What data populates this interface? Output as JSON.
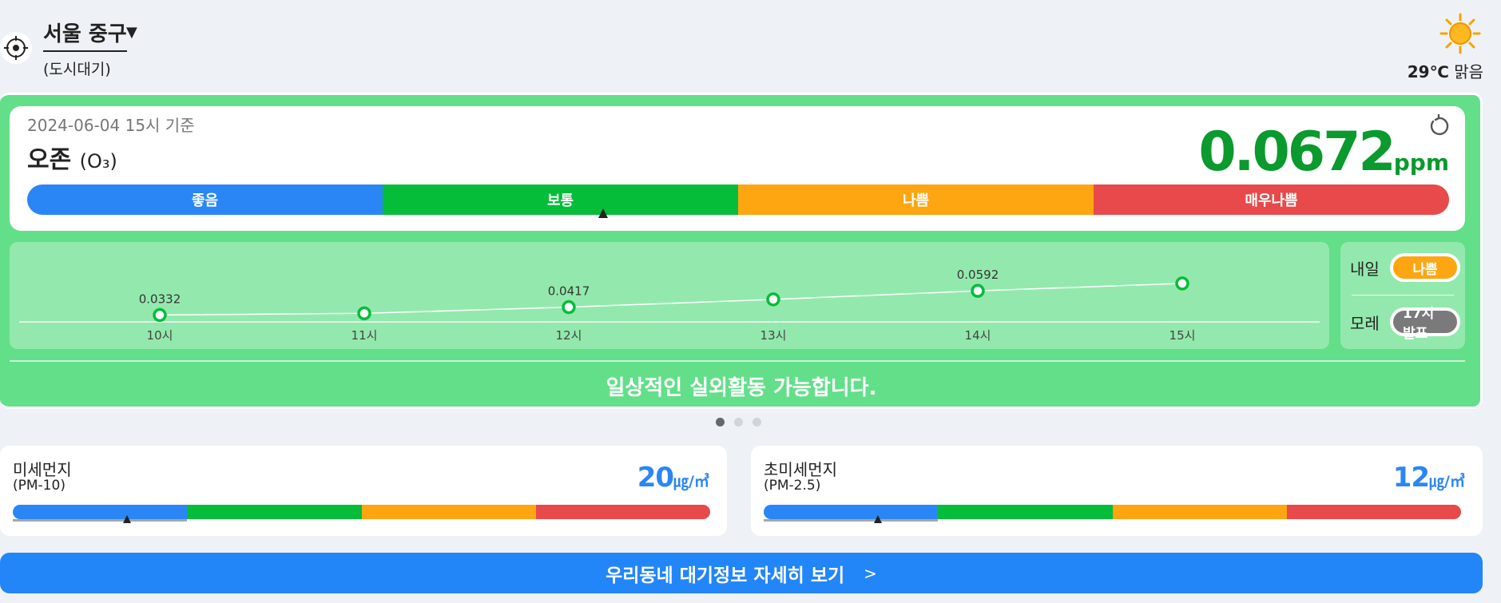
{
  "location": {
    "name": "서울 중구",
    "station_type": "(도시대기)"
  },
  "weather": {
    "temperature": "29℃",
    "condition": "맑음",
    "icon": "sun-icon"
  },
  "main": {
    "base_time": "2024-06-04 15시 기준",
    "pollutant_name": "오존",
    "pollutant_symbol": "(O₃)",
    "value": "0.0672",
    "unit": "ppm",
    "grades": [
      "좋음",
      "보통",
      "나쁨",
      "매우나쁨"
    ],
    "active_grade_index": 1,
    "marker_position_fraction": 0.405,
    "message": "일상적인 실외활동 가능합니다.",
    "colors": {
      "good": "#2b86f5",
      "normal": "#06bd3a",
      "bad": "#fea512",
      "very_bad": "#e8494a",
      "value": "#0a9a2e"
    }
  },
  "chart_data": {
    "type": "line",
    "x": [
      "10시",
      "11시",
      "12시",
      "13시",
      "14시",
      "15시"
    ],
    "series": [
      {
        "values": [
          0.0332,
          0.035,
          0.0417,
          0.05,
          0.0592,
          0.0672
        ]
      }
    ],
    "data_labels": [
      "0.0332",
      "",
      "0.0417",
      "",
      "0.0592",
      ""
    ],
    "ylim": [
      0,
      0.12
    ]
  },
  "forecast": {
    "tomorrow_label": "내일",
    "tomorrow_value": "나쁨",
    "day_after_label": "모레",
    "day_after_value": "17시 발표"
  },
  "pager": {
    "count": 3,
    "active": 0
  },
  "pm10": {
    "title": "미세먼지",
    "subtitle": "(PM-10)",
    "value": "20",
    "unit": "㎍/㎥",
    "active_grade_index": 0,
    "marker_position_fraction": 0.165
  },
  "pm25": {
    "title": "초미세먼지",
    "subtitle": "(PM-2.5)",
    "value": "12",
    "unit": "㎍/㎥",
    "active_grade_index": 0,
    "marker_position_fraction": 0.165
  },
  "detail_button": {
    "label": "우리동네 대기정보 자세히 보기",
    "chevron": ">"
  }
}
